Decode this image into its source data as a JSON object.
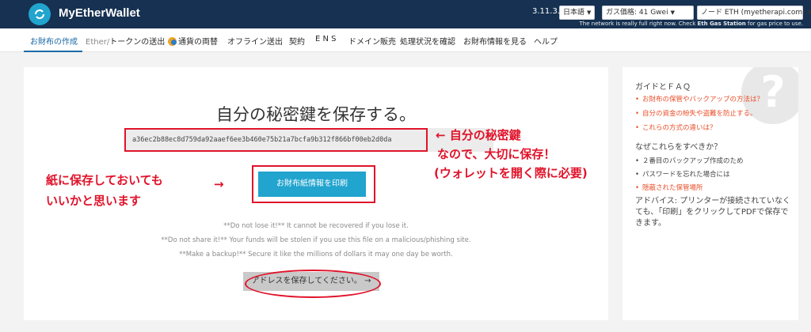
{
  "header": {
    "brand": "MyEtherWallet",
    "version": "3.11.3.3",
    "language": "日本語",
    "gas_price": "ガス価格: 41 Gwei",
    "node": "ノード ETH (myetherapi.com)",
    "notice_prefix": "The network is really full right now. Check ",
    "notice_link": "Eth Gas Station",
    "notice_suffix": " for gas price to use."
  },
  "nav": {
    "items": [
      {
        "label": "お財布の作成"
      },
      {
        "prefix": "Ether/",
        "label": "トークンの送出"
      },
      {
        "label": "通貨の両替"
      },
      {
        "label": "オフライン送出"
      },
      {
        "label": "契約"
      },
      {
        "label": "E N S"
      },
      {
        "label": "ドメイン販売"
      },
      {
        "label": "処理状況を確認"
      },
      {
        "label": "お財布情報を見る"
      },
      {
        "label": "ヘルプ"
      }
    ]
  },
  "main": {
    "title": "自分の秘密鍵を保存する。",
    "private_key": "a36ec2b88ec8d759da92aaef6ee3b460e75b21a7bcfa9b312f866bf00eb2d0da",
    "print_button": "お財布紙情報を印刷",
    "warnings": [
      "**Do not lose it!** It cannot be recovered if you lose it.",
      "**Do not share it!** Your funds will be stolen if you use this file on a malicious/phishing site.",
      "**Make a backup!** Secure it like the millions of dollars it may one day be worth."
    ],
    "save_button": "アドレスを保存してください。 →"
  },
  "annotations": {
    "key_note_line1": "← 自分の秘密鍵",
    "key_note_line2": "なので、大切に保存！",
    "key_note_line3": "(ウォレットを開く際に必要)",
    "print_note_line1": "紙に保存しておいても",
    "print_note_line2": "いいかと思います",
    "print_note_arrow": "→"
  },
  "side": {
    "badge": "?",
    "guide_title": "ガイドとＦＡＱ",
    "guide_links": [
      "お財布の保管やバックアップの方法は？",
      "自分の資金の紛失や盗難を防止する。",
      "これらの方式の違いは？"
    ],
    "why_title": "なぜこれらをすべきか？",
    "why_items": [
      "２番目のバックアップ作成のため",
      "パスワードを忘れた場合には"
    ],
    "why_link": "隠蔽された保管場所",
    "advice": "アドバイス: プリンターが接続されていなくても、「印刷」をクリックしてPDFで保存できます。"
  },
  "colors": {
    "header_bg": "#163151",
    "accent": "#21a4ce",
    "annotation": "#e0132a",
    "link": "#e94f2a"
  }
}
